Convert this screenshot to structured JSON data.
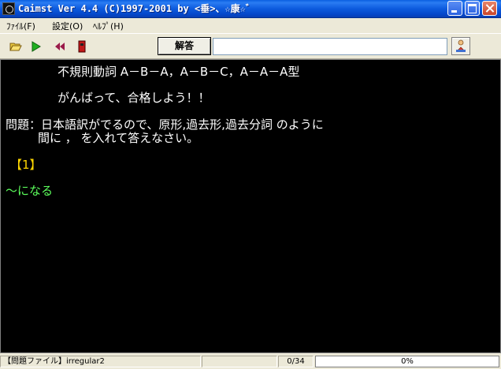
{
  "window": {
    "title": "Caimst Ver 4.4 (C)1997-2001  by <垂>、☆康☆゛"
  },
  "menu": {
    "items": [
      "ﾌｧｲﾙ(F)",
      "設定(O)",
      "ﾍﾙﾌﾟ(H)"
    ]
  },
  "toolbar": {
    "answer_label": "解答",
    "answer_value": ""
  },
  "content": {
    "lines": [
      "不規則動詞 A－B－A，A－B－C，A－A－A型",
      "がんばって、合格しよう！！",
      "問題：日本語訳がでるので、原形,過去形,過去分詞 のように",
      "間に ， を入れて答えなさい。",
      "【1】",
      "～になる"
    ]
  },
  "status": {
    "file_label": "【問題ファイル】irregular2",
    "counter": "0/34",
    "progress_text": "0%",
    "progress_fraction": 0
  },
  "colors": {
    "background": "#000000",
    "text": "#ffffff",
    "question_number": "#ffd700",
    "prompt": "#5cff5c"
  }
}
